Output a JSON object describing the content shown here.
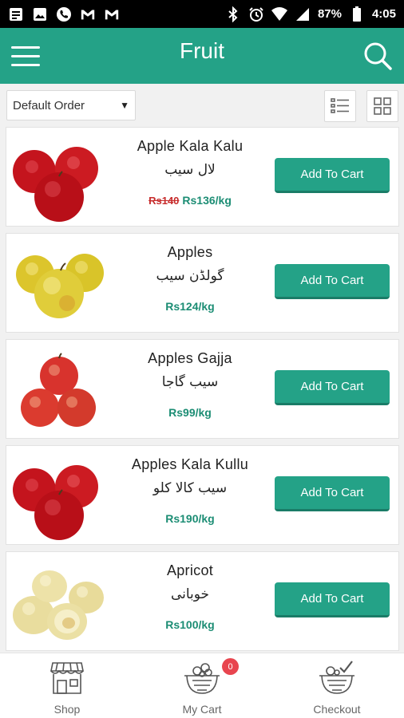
{
  "status_bar": {
    "battery": "87%",
    "time": "4:05"
  },
  "app_bar": {
    "title": "Fruit"
  },
  "toolbar": {
    "sort_label": "Default Order",
    "sort_arrow": "▼"
  },
  "products": [
    {
      "name": "Apple Kala Kalu",
      "urdu": "لال سیب",
      "old_price": "Rs140",
      "price": "Rs136/kg",
      "button": "Add To Cart",
      "image": "red-apples"
    },
    {
      "name": "Apples",
      "urdu": "گولڈن سیب",
      "old_price": "",
      "price": "Rs124/kg",
      "button": "Add To Cart",
      "image": "golden-apples"
    },
    {
      "name": "Apples Gajja",
      "urdu": "سیب گاجا",
      "old_price": "",
      "price": "Rs99/kg",
      "button": "Add To Cart",
      "image": "gajja-apples"
    },
    {
      "name": "Apples Kala Kullu",
      "urdu": "سیب کالا کلو",
      "old_price": "",
      "price": "Rs190/kg",
      "button": "Add To Cart",
      "image": "red-apples"
    },
    {
      "name": "Apricot",
      "urdu": "خوبانی",
      "old_price": "",
      "price": "Rs100/kg",
      "button": "Add To Cart",
      "image": "apricots"
    }
  ],
  "bottom_nav": {
    "shop": "Shop",
    "cart": "My Cart",
    "cart_count": "0",
    "checkout": "Checkout"
  },
  "colors": {
    "primary": "#24a287",
    "price": "#1c8d74",
    "old_price": "#c72c2c",
    "badge": "#e8454f"
  }
}
